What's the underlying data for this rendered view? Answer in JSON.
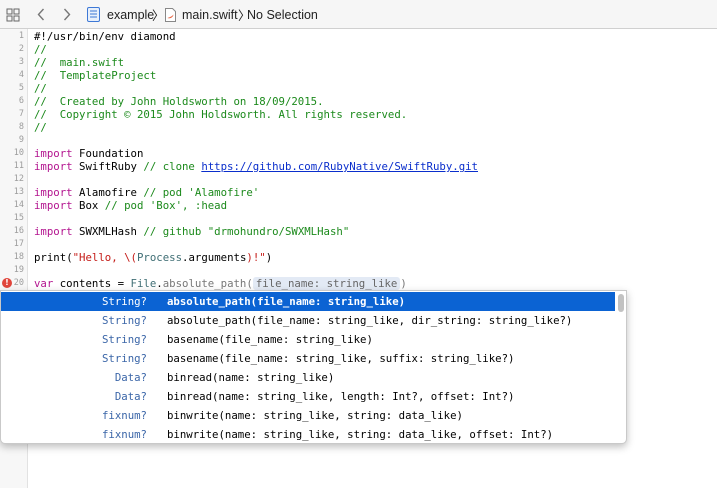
{
  "breadcrumb": {
    "project": "example",
    "file": "main.swift",
    "selection": "No Selection",
    "separator": "〉"
  },
  "icons": {
    "grid": "grid-icon",
    "back": "chevron-left-icon",
    "forward": "chevron-right-icon",
    "project": "xcode-project-icon",
    "file": "swift-file-icon",
    "error": "error-icon"
  },
  "colors": {
    "comment": "#1c8a1c",
    "keyword": "#b3148f",
    "string": "#c41a16",
    "type": "#3f6e74",
    "link": "#0a2ecc",
    "selection": "#0b63d3",
    "autocomplete_type": "#3b66a8",
    "error": "#e0453b"
  },
  "code_lines": [
    {
      "n": "1",
      "parts": [
        {
          "t": "#!/usr/bin/env diamond",
          "c": "plain"
        }
      ]
    },
    {
      "n": "2",
      "parts": [
        {
          "t": "//",
          "c": "comment"
        }
      ]
    },
    {
      "n": "3",
      "parts": [
        {
          "t": "//  main.swift",
          "c": "comment"
        }
      ]
    },
    {
      "n": "4",
      "parts": [
        {
          "t": "//  TemplateProject",
          "c": "comment"
        }
      ]
    },
    {
      "n": "5",
      "parts": [
        {
          "t": "//",
          "c": "comment"
        }
      ]
    },
    {
      "n": "6",
      "parts": [
        {
          "t": "//  Created by John Holdsworth on 18/09/2015.",
          "c": "comment"
        }
      ]
    },
    {
      "n": "7",
      "parts": [
        {
          "t": "//  Copyright © 2015 John Holdsworth. All rights reserved.",
          "c": "comment"
        }
      ]
    },
    {
      "n": "8",
      "parts": [
        {
          "t": "//",
          "c": "comment"
        }
      ]
    },
    {
      "n": "9",
      "parts": []
    },
    {
      "n": "10",
      "parts": [
        {
          "t": "import",
          "c": "keyword"
        },
        {
          "t": " Foundation",
          "c": "plain"
        }
      ]
    },
    {
      "n": "11",
      "parts": [
        {
          "t": "import",
          "c": "keyword"
        },
        {
          "t": " SwiftRuby ",
          "c": "plain"
        },
        {
          "t": "// clone ",
          "c": "comment"
        },
        {
          "t": "https://github.com/RubyNative/SwiftRuby.git",
          "c": "link"
        }
      ]
    },
    {
      "n": "12",
      "parts": []
    },
    {
      "n": "13",
      "parts": [
        {
          "t": "import",
          "c": "keyword"
        },
        {
          "t": " Alamofire ",
          "c": "plain"
        },
        {
          "t": "// pod 'Alamofire'",
          "c": "comment"
        }
      ]
    },
    {
      "n": "14",
      "parts": [
        {
          "t": "import",
          "c": "keyword"
        },
        {
          "t": " Box ",
          "c": "plain"
        },
        {
          "t": "// pod 'Box', :head",
          "c": "comment"
        }
      ]
    },
    {
      "n": "15",
      "parts": []
    },
    {
      "n": "16",
      "parts": [
        {
          "t": "import",
          "c": "keyword"
        },
        {
          "t": " SWXMLHash ",
          "c": "plain"
        },
        {
          "t": "// github \"drmohundro/SWXMLHash\"",
          "c": "comment"
        }
      ]
    },
    {
      "n": "17",
      "parts": []
    },
    {
      "n": "18",
      "parts": [
        {
          "t": "print",
          "c": "plain"
        },
        {
          "t": "(",
          "c": "plain"
        },
        {
          "t": "\"Hello, \\(",
          "c": "string"
        },
        {
          "t": "Process",
          "c": "type"
        },
        {
          "t": ".arguments",
          "c": "plain"
        },
        {
          "t": ")!\"",
          "c": "string"
        },
        {
          "t": ")",
          "c": "plain"
        }
      ]
    },
    {
      "n": "19",
      "parts": []
    },
    {
      "n": "20",
      "error": true,
      "parts": [
        {
          "t": "var",
          "c": "keyword"
        },
        {
          "t": " contents = ",
          "c": "plain"
        },
        {
          "t": "File",
          "c": "type"
        },
        {
          "t": ".",
          "c": "plain"
        },
        {
          "t": "absolute_path",
          "c": "dim"
        },
        {
          "t": "(",
          "c": "dim"
        },
        {
          "t": "file_name: string_like",
          "c": "placeholder"
        },
        {
          "t": ")",
          "c": "dim"
        }
      ]
    }
  ],
  "autocomplete": {
    "items": [
      {
        "type": "String?",
        "signature": "absolute_path(file_name: string_like)",
        "selected": true
      },
      {
        "type": "String?",
        "signature": "absolute_path(file_name: string_like, dir_string: string_like?)"
      },
      {
        "type": "String?",
        "signature": "basename(file_name: string_like)"
      },
      {
        "type": "String?",
        "signature": "basename(file_name: string_like, suffix: string_like?)"
      },
      {
        "type": "Data?",
        "signature": "binread(name: string_like)"
      },
      {
        "type": "Data?",
        "signature": "binread(name: string_like, length: Int?, offset: Int?)"
      },
      {
        "type": "fixnum?",
        "signature": "binwrite(name: string_like, string: data_like)"
      },
      {
        "type": "fixnum?",
        "signature": "binwrite(name: string_like, string: data_like, offset: Int?)"
      }
    ]
  }
}
